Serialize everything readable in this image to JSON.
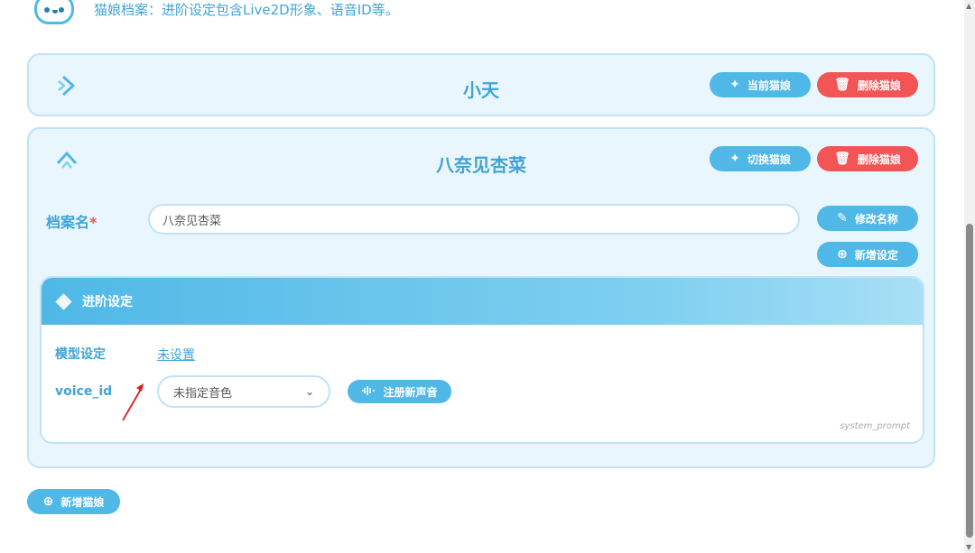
{
  "header": {
    "description": "猫娘档案：进阶设定包含Live2D形象、语音ID等。"
  },
  "profiles": [
    {
      "name": "小天",
      "primary_action": "当前猫娘",
      "delete_action": "删除猫娘"
    },
    {
      "name": "八奈见杏菜",
      "primary_action": "切换猫娘",
      "delete_action": "删除猫娘",
      "name_field_label": "档案名",
      "required_mark": "*",
      "name_field_value": "八奈见杏菜",
      "rename_action": "修改名称",
      "add_setting_action": "新增设定",
      "advanced": {
        "title": "进阶设定",
        "model_label": "模型设定",
        "model_value": "未设置",
        "voice_label": "voice_id",
        "voice_select_value": "未指定音色",
        "register_voice_action": "注册新声音",
        "footer_hint": "system_prompt"
      }
    }
  ],
  "add_profile_action": "新增猫娘",
  "colors": {
    "accent": "#4fb8e6",
    "danger": "#f25555",
    "card_bg": "#eaf6fd",
    "card_border": "#bfe3f6",
    "annotation_arrow": "#d62020"
  }
}
